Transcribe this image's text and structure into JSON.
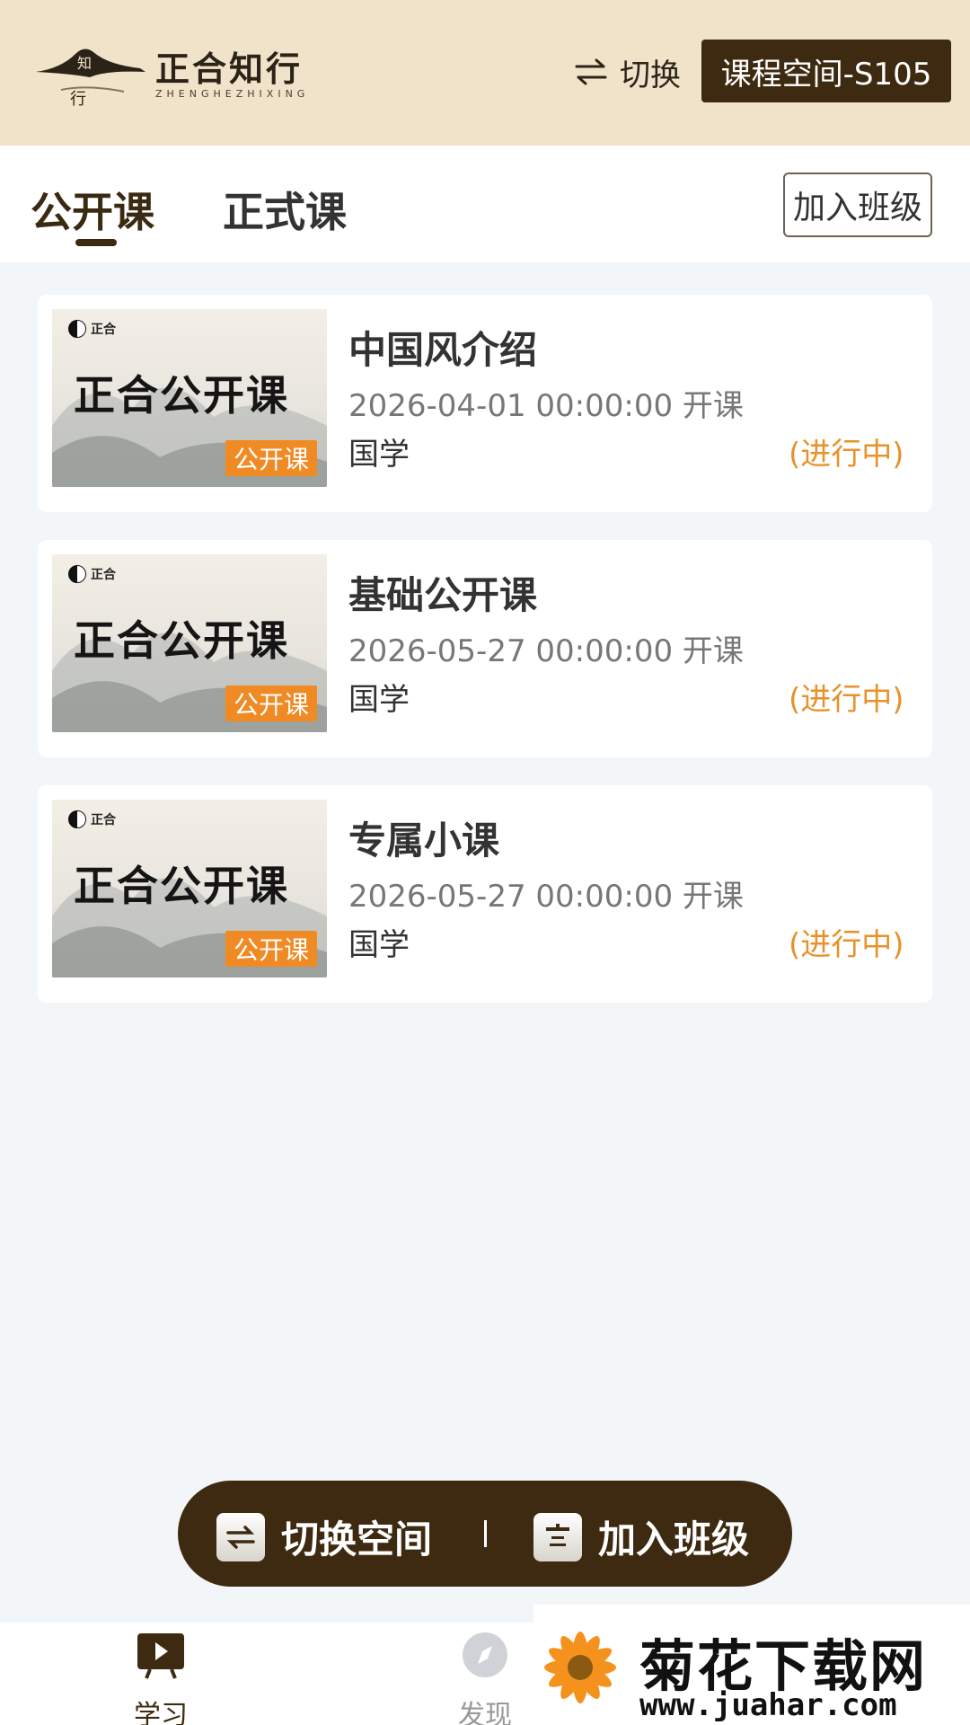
{
  "header": {
    "logo_title": "正合知行",
    "logo_subtitle": "ZHENGHEZHIXING",
    "logo_mark_chars": [
      "知",
      "行"
    ],
    "switch_label": "切换",
    "space_label": "课程空间-S105"
  },
  "tabs": {
    "items": [
      {
        "label": "公开课",
        "active": true
      },
      {
        "label": "正式课",
        "active": false
      }
    ],
    "join_button": "加入班级"
  },
  "courses": [
    {
      "thumb_brand": "正合",
      "thumb_title": "正合公开课",
      "thumb_tag": "公开课",
      "title": "中国风介绍",
      "date": "2026-04-01 00:00:00 开课",
      "category": "国学",
      "status": "(进行中)"
    },
    {
      "thumb_brand": "正合",
      "thumb_title": "正合公开课",
      "thumb_tag": "公开课",
      "title": "基础公开课",
      "date": "2026-05-27 00:00:00 开课",
      "category": "国学",
      "status": "(进行中)"
    },
    {
      "thumb_brand": "正合",
      "thumb_title": "正合公开课",
      "thumb_tag": "公开课",
      "title": "专属小课",
      "date": "2026-05-27 00:00:00 开课",
      "category": "国学",
      "status": "(进行中)"
    }
  ],
  "float_bar": {
    "switch_space": "切换空间",
    "join_class": "加入班级"
  },
  "bottom_nav": {
    "items": [
      {
        "label": "学习",
        "icon": "play-board-icon",
        "active": true
      },
      {
        "label": "发现",
        "icon": "compass-icon",
        "active": false
      }
    ]
  },
  "watermark": {
    "title": "菊花下载网",
    "url": "www.juahar.com"
  },
  "colors": {
    "header_bg": "#f1e3c9",
    "brand_dark": "#3e2a10",
    "status_orange": "#e8922a",
    "tag_orange": "#f08a24"
  }
}
